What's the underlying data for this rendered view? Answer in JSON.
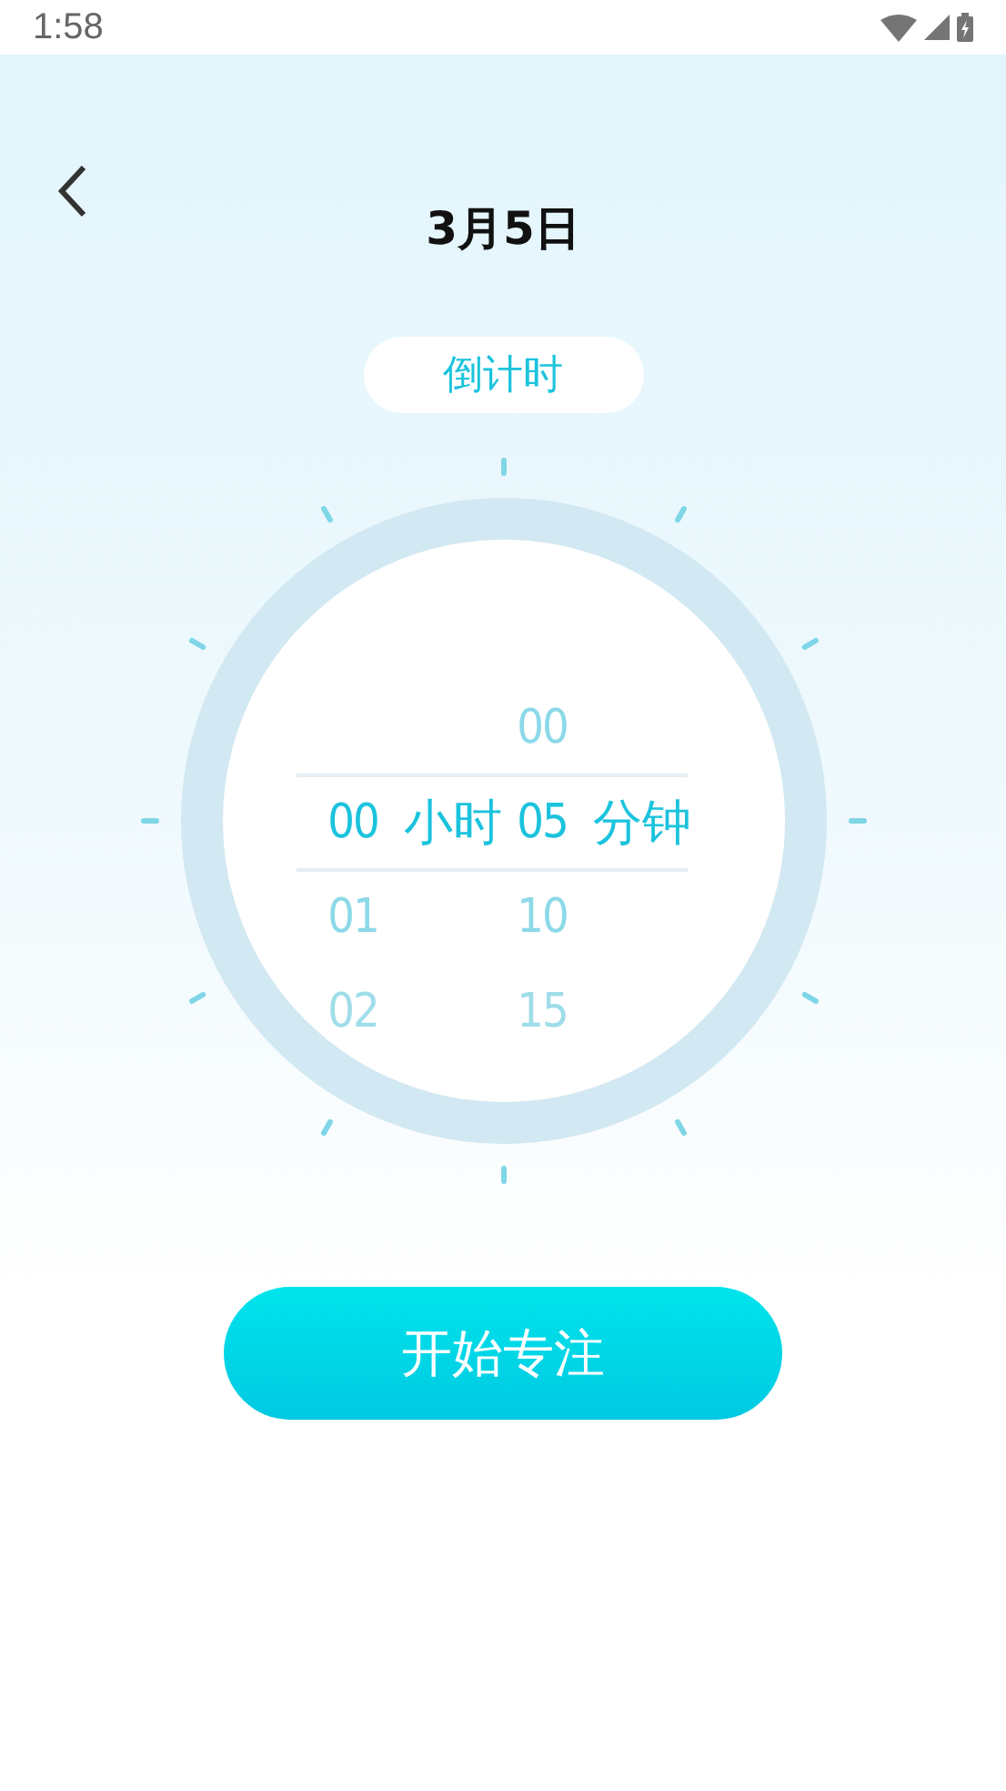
{
  "status_bar": {
    "time": "1:58"
  },
  "header": {
    "title": "3月5日"
  },
  "mode_pill": {
    "label": "倒计时"
  },
  "picker": {
    "columns": [
      {
        "unit": "小时",
        "items": [
          {
            "value": "00",
            "selected": true
          },
          {
            "value": "01",
            "selected": false
          },
          {
            "value": "02",
            "selected": false
          }
        ]
      },
      {
        "unit": "分钟",
        "items": [
          {
            "value": "00",
            "selected": false
          },
          {
            "value": "05",
            "selected": true
          },
          {
            "value": "10",
            "selected": false
          },
          {
            "value": "15",
            "selected": false
          }
        ]
      }
    ]
  },
  "start_button": {
    "label": "开始专注"
  }
}
